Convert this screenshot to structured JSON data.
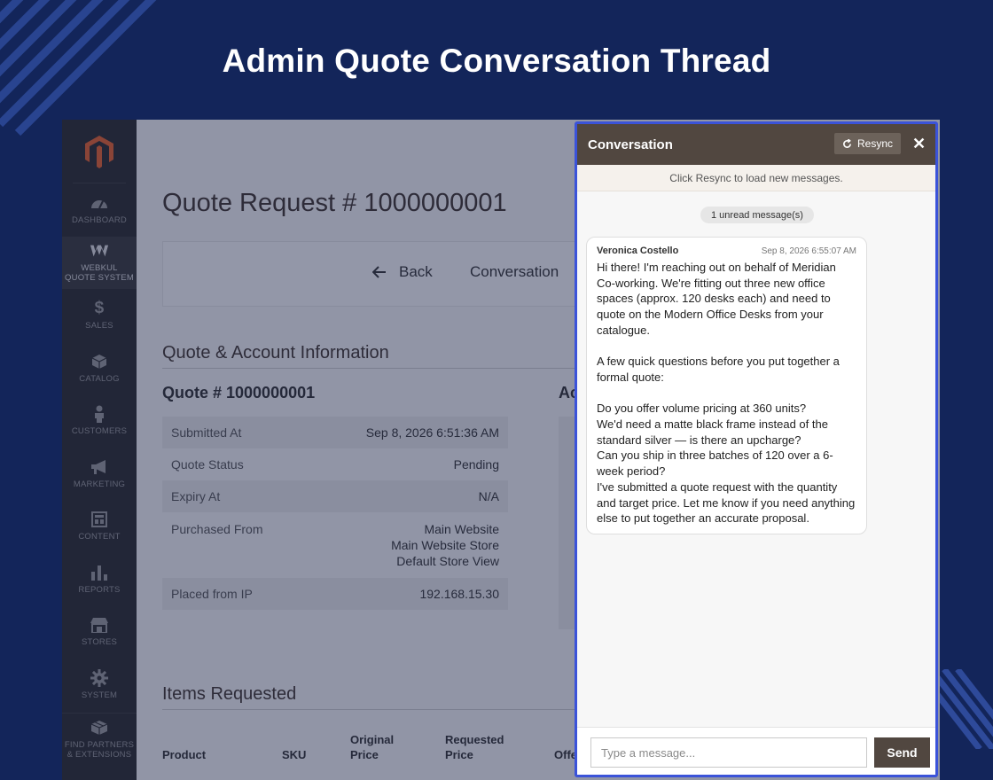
{
  "banner": {
    "title": "Admin Quote Conversation Thread"
  },
  "sidebar": {
    "items": [
      {
        "label": "DASHBOARD",
        "icon": "dashboard-icon"
      },
      {
        "label": "WEBKUL\nQUOTE SYSTEM",
        "icon": "webkul-logo-icon"
      },
      {
        "label": "SALES",
        "icon": "dollar-icon"
      },
      {
        "label": "CATALOG",
        "icon": "cube-icon"
      },
      {
        "label": "CUSTOMERS",
        "icon": "person-icon"
      },
      {
        "label": "MARKETING",
        "icon": "megaphone-icon"
      },
      {
        "label": "CONTENT",
        "icon": "layout-icon"
      },
      {
        "label": "REPORTS",
        "icon": "bar-chart-icon"
      },
      {
        "label": "STORES",
        "icon": "storefront-icon"
      },
      {
        "label": "SYSTEM",
        "icon": "gear-icon"
      },
      {
        "label": "FIND PARTNERS\n& EXTENSIONS",
        "icon": "box-icon"
      }
    ]
  },
  "page": {
    "title": "Quote Request # 1000000001",
    "back_label": "Back",
    "conversation_label": "Conversation",
    "section_quote_account": "Quote & Account Information",
    "quote_number": "Quote # 1000000001",
    "account_heading_partial": "Ac",
    "info_rows": [
      {
        "label": "Submitted At",
        "value": "Sep 8, 2026 6:51:36 AM"
      },
      {
        "label": "Quote Status",
        "value": "Pending"
      },
      {
        "label": "Expiry At",
        "value": "N/A"
      },
      {
        "label": "Purchased From",
        "value": "Main Website\nMain Website Store\nDefault Store View"
      },
      {
        "label": "Placed from IP",
        "value": "192.168.15.30"
      }
    ],
    "section_items": "Items Requested",
    "items_columns": [
      "Product",
      "SKU",
      "Original\nPrice",
      "Requested\nPrice",
      "Offe"
    ]
  },
  "conversation": {
    "title": "Conversation",
    "resync_label": "Resync",
    "close_label": "✕",
    "hint": "Click Resync to load new messages.",
    "unread": "1 unread message(s)",
    "messages": [
      {
        "sender": "Veronica Costello",
        "time": "Sep 8, 2026 6:55:07 AM",
        "body": "Hi there! I'm reaching out on behalf of Meridian Co-working. We're fitting out three new office spaces (approx. 120 desks each) and need to quote on the Modern Office Desks from your catalogue.\n\nA few quick questions before you put together a formal quote:\n\nDo you offer volume pricing at 360 units?\nWe'd need a matte black frame instead of the standard silver — is there an upcharge?\nCan you ship in three batches of 120 over a 6-week period?\nI've submitted a quote request with the quantity and target price. Let me know if you need anything else to put together an accurate proposal."
      }
    ],
    "input_placeholder": "Type a message...",
    "send_label": "Send"
  },
  "colors": {
    "background": "#13255a",
    "panel_header": "#514740",
    "panel_border": "#3b53d9",
    "send_button": "#514740"
  }
}
